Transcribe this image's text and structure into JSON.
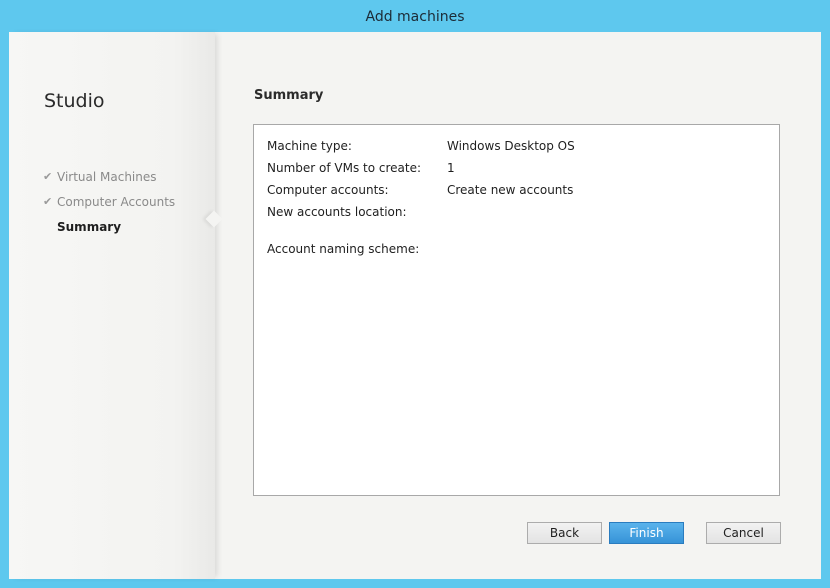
{
  "window": {
    "title": "Add machines"
  },
  "sidebar": {
    "brand": "Studio",
    "steps": [
      {
        "label": "Virtual Machines",
        "completed": true
      },
      {
        "label": "Computer Accounts",
        "completed": true
      },
      {
        "label": "Summary",
        "current": true
      }
    ]
  },
  "main": {
    "heading": "Summary",
    "summary": {
      "rows": [
        {
          "label": "Machine type:",
          "value": "Windows Desktop OS"
        },
        {
          "label": "Number of VMs to create:",
          "value": "1"
        },
        {
          "label": "Computer accounts:",
          "value": "Create new accounts"
        },
        {
          "label": "New accounts location:",
          "value": ""
        },
        {
          "label": "Account naming scheme:",
          "value": ""
        }
      ]
    }
  },
  "buttons": {
    "back": "Back",
    "finish": "Finish",
    "cancel": "Cancel"
  },
  "icons": {
    "step_complete": "checkmark-icon"
  },
  "colors": {
    "titlebar": "#5ec8ee",
    "primary_button": "#3693d8"
  }
}
